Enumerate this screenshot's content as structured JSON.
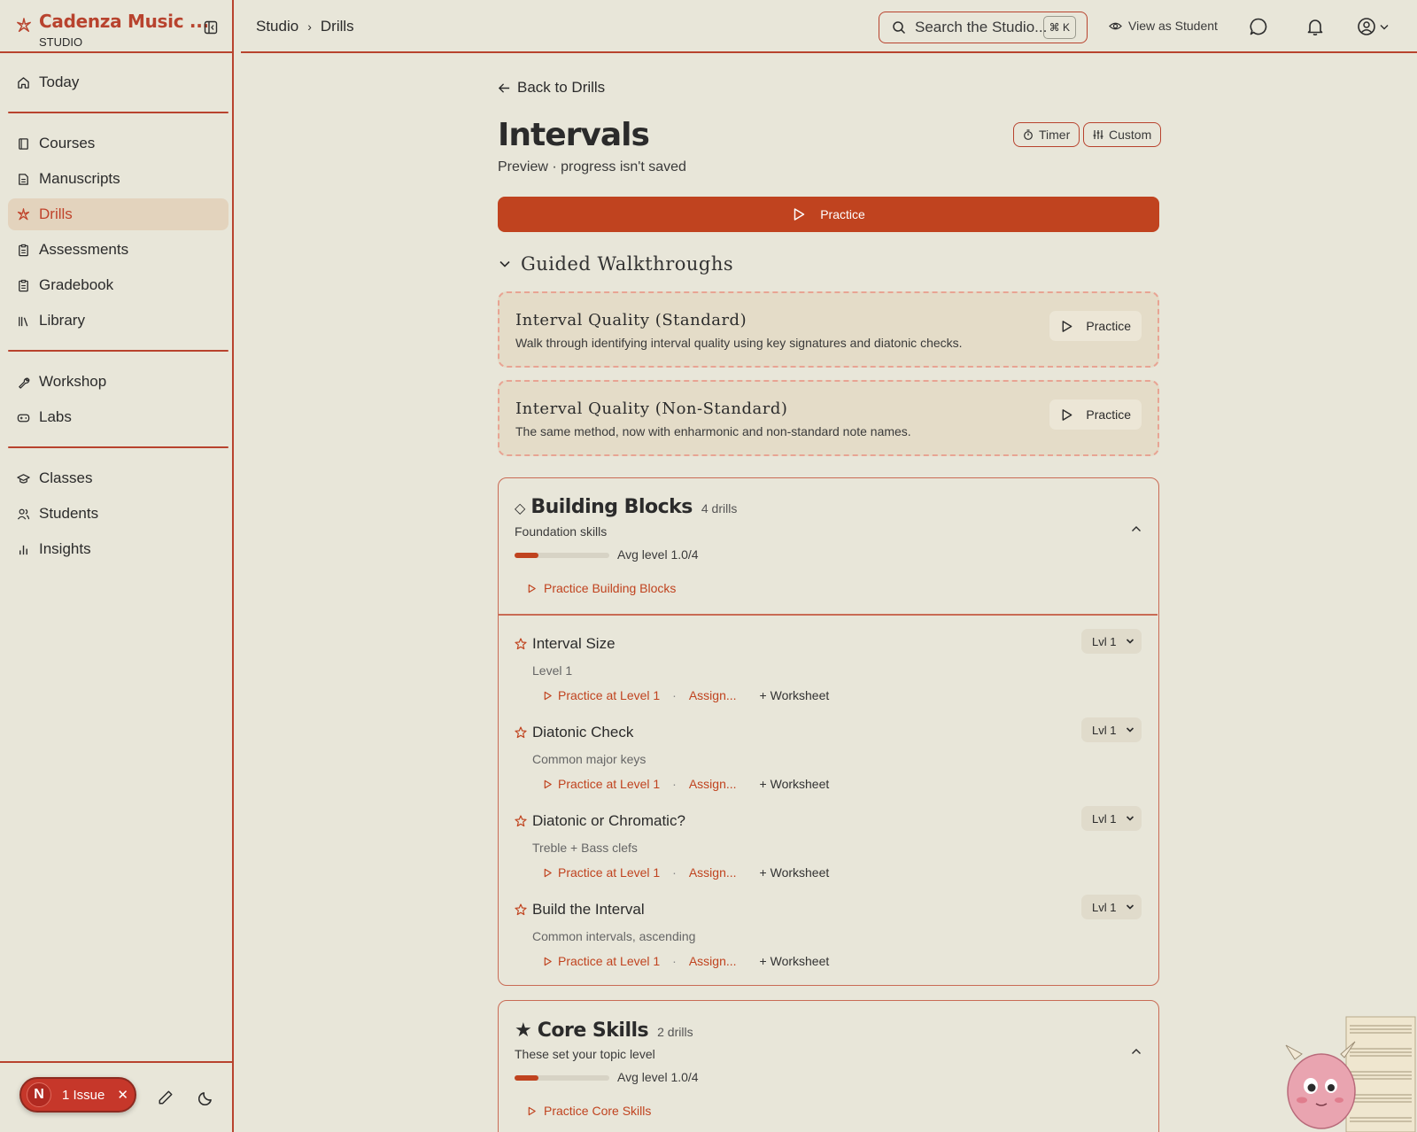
{
  "app": {
    "title": "Cadenza Music ...",
    "subtitle": "STUDIO"
  },
  "sidebar": {
    "items": [
      {
        "label": "Today",
        "icon": "home-icon"
      },
      {
        "label": "Courses",
        "icon": "book-icon"
      },
      {
        "label": "Manuscripts",
        "icon": "document-icon"
      },
      {
        "label": "Drills",
        "icon": "sparkle-icon",
        "active": true
      },
      {
        "label": "Assessments",
        "icon": "clipboard-icon"
      },
      {
        "label": "Gradebook",
        "icon": "clipboard-icon"
      },
      {
        "label": "Library",
        "icon": "library-icon"
      },
      {
        "label": "Workshop",
        "icon": "wrench-icon"
      },
      {
        "label": "Labs",
        "icon": "gamepad-icon"
      },
      {
        "label": "Classes",
        "icon": "graduation-cap-icon"
      },
      {
        "label": "Students",
        "icon": "users-icon"
      },
      {
        "label": "Insights",
        "icon": "bar-chart-icon"
      }
    ],
    "issue": {
      "badge": "N",
      "label": "1 Issue",
      "close": "✕"
    }
  },
  "header": {
    "breadcrumb": [
      "Studio",
      "Drills"
    ],
    "search_placeholder": "Search the Studio...",
    "search_shortcut": "⌘ K",
    "view_as_student": "View as Student"
  },
  "page": {
    "back": "Back to Drills",
    "title": "Intervals",
    "subtitle": "Preview · progress isn't saved",
    "timer": "Timer",
    "custom": "Custom",
    "practice": "Practice"
  },
  "walkthroughs": {
    "heading": "Guided Walkthroughs",
    "items": [
      {
        "title": "Interval Quality (Standard)",
        "desc": "Walk through identifying interval quality using key signatures and diatonic checks.",
        "button": "Practice"
      },
      {
        "title": "Interval Quality (Non-Standard)",
        "desc": "The same method, now with enharmonic and non-standard note names.",
        "button": "Practice"
      }
    ]
  },
  "sections": [
    {
      "glyph": "◇",
      "name": "Building Blocks",
      "count": "4 drills",
      "subtitle": "Foundation skills",
      "avg": "Avg level  1.0/4",
      "progress": 0.25,
      "practice": "Practice Building Blocks",
      "drills": [
        {
          "name": "Interval Size",
          "desc": "Level 1",
          "practice": "Practice at Level 1",
          "dot": "·",
          "assign": "Assign...",
          "worksheet": "+ Worksheet",
          "level": "Lvl 1"
        },
        {
          "name": "Diatonic Check",
          "desc": "Common major keys",
          "practice": "Practice at Level 1",
          "dot": "·",
          "assign": "Assign...",
          "worksheet": "+ Worksheet",
          "level": "Lvl 1"
        },
        {
          "name": "Diatonic or Chromatic?",
          "desc": "Treble + Bass clefs",
          "practice": "Practice at Level 1",
          "dot": "·",
          "assign": "Assign...",
          "worksheet": "+ Worksheet",
          "level": "Lvl 1"
        },
        {
          "name": "Build the Interval",
          "desc": "Common intervals, ascending",
          "practice": "Practice at Level 1",
          "dot": "·",
          "assign": "Assign...",
          "worksheet": "+ Worksheet",
          "level": "Lvl 1"
        }
      ]
    },
    {
      "glyph": "★",
      "name": "Core Skills",
      "count": "2 drills",
      "subtitle": "These set your topic level",
      "avg": "Avg level  1.0/4",
      "progress": 0.25,
      "practice": "Practice Core Skills",
      "drills": []
    }
  ],
  "colors": {
    "accent": "#c0431f",
    "background": "#e8e6d9",
    "rule": "#b8432e"
  }
}
